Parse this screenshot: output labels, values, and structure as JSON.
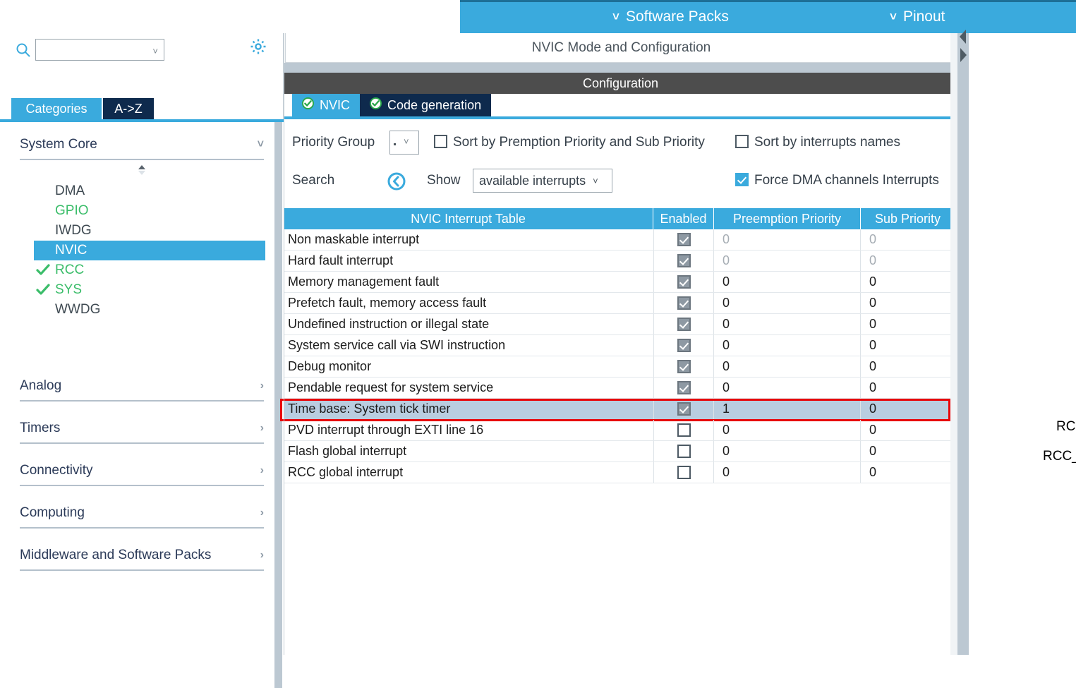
{
  "topbar": {
    "items": [
      {
        "label": "Software Packs",
        "icon": "chevron-down-icon"
      },
      {
        "label": "Pinout",
        "icon": "chevron-down-icon"
      }
    ]
  },
  "sidebar": {
    "search": {
      "value": "",
      "placeholder": ""
    },
    "gear_icon": "gear-icon",
    "search_icon": "search-icon",
    "tabs": [
      {
        "label": "Categories",
        "active": true
      },
      {
        "label": "A->Z",
        "active": false
      }
    ],
    "groups": [
      {
        "label": "System Core",
        "expanded": true,
        "arrow": "chevron-down-icon",
        "items": [
          {
            "label": "DMA",
            "state": "normal",
            "check": false
          },
          {
            "label": "GPIO",
            "state": "configured",
            "check": false
          },
          {
            "label": "IWDG",
            "state": "normal",
            "check": false
          },
          {
            "label": "NVIC",
            "state": "selected",
            "check": false
          },
          {
            "label": "RCC",
            "state": "configured",
            "check": true
          },
          {
            "label": "SYS",
            "state": "configured",
            "check": true
          },
          {
            "label": "WWDG",
            "state": "normal",
            "check": false
          }
        ]
      },
      {
        "label": "Analog",
        "expanded": false,
        "arrow": "chevron-right-icon",
        "items": []
      },
      {
        "label": "Timers",
        "expanded": false,
        "arrow": "chevron-right-icon",
        "items": []
      },
      {
        "label": "Connectivity",
        "expanded": false,
        "arrow": "chevron-right-icon",
        "items": []
      },
      {
        "label": "Computing",
        "expanded": false,
        "arrow": "chevron-right-icon",
        "items": []
      },
      {
        "label": "Middleware and Software Packs",
        "expanded": false,
        "arrow": "chevron-right-icon",
        "items": []
      }
    ]
  },
  "main": {
    "panel_title": "NVIC Mode and Configuration",
    "configuration_bar": "Configuration",
    "tabs": [
      {
        "label": "NVIC",
        "active": true,
        "icon": "green-check-circle-icon"
      },
      {
        "label": "Code generation",
        "active": false,
        "icon": "green-check-circle-icon"
      }
    ],
    "controls": {
      "priority_group_label": "Priority Group",
      "priority_group_value": ".",
      "sort_premption_label": "Sort by Premption Priority and Sub Priority",
      "sort_premption_checked": false,
      "sort_names_label": "Sort by interrupts names",
      "sort_names_checked": false,
      "search_label": "Search",
      "search_icon": "search-circle-icon",
      "show_label": "Show",
      "show_value": "available interrupts",
      "force_dma_label": "Force DMA channels Interrupts",
      "force_dma_checked": true
    },
    "table": {
      "columns": [
        "NVIC Interrupt Table",
        "Enabled",
        "Preemption Priority",
        "Sub Priority"
      ],
      "rows": [
        {
          "name": "Non maskable interrupt",
          "enabled": "disabled-checked",
          "preemption": "0",
          "sub": "0",
          "muted": true,
          "highlight": false
        },
        {
          "name": "Hard fault interrupt",
          "enabled": "disabled-checked",
          "preemption": "0",
          "sub": "0",
          "muted": true,
          "highlight": false
        },
        {
          "name": "Memory management fault",
          "enabled": "disabled-checked",
          "preemption": "0",
          "sub": "0",
          "muted": false,
          "highlight": false
        },
        {
          "name": "Prefetch fault, memory access fault",
          "enabled": "disabled-checked",
          "preemption": "0",
          "sub": "0",
          "muted": false,
          "highlight": false
        },
        {
          "name": "Undefined instruction or illegal state",
          "enabled": "disabled-checked",
          "preemption": "0",
          "sub": "0",
          "muted": false,
          "highlight": false
        },
        {
          "name": "System service call via SWI instruction",
          "enabled": "disabled-checked",
          "preemption": "0",
          "sub": "0",
          "muted": false,
          "highlight": false
        },
        {
          "name": "Debug monitor",
          "enabled": "disabled-checked",
          "preemption": "0",
          "sub": "0",
          "muted": false,
          "highlight": false
        },
        {
          "name": "Pendable request for system service",
          "enabled": "disabled-checked",
          "preemption": "0",
          "sub": "0",
          "muted": false,
          "highlight": false
        },
        {
          "name": "Time base: System tick timer",
          "enabled": "disabled-checked",
          "preemption": "1",
          "sub": "0",
          "muted": false,
          "highlight": true
        },
        {
          "name": "PVD interrupt through EXTI line 16",
          "enabled": "unchecked",
          "preemption": "0",
          "sub": "0",
          "muted": false,
          "highlight": false
        },
        {
          "name": "Flash global interrupt",
          "enabled": "unchecked",
          "preemption": "0",
          "sub": "0",
          "muted": false,
          "highlight": false
        },
        {
          "name": "RCC global interrupt",
          "enabled": "unchecked",
          "preemption": "0",
          "sub": "0",
          "muted": false,
          "highlight": false
        }
      ]
    }
  },
  "right_panel": {
    "partial_labels": [
      "RC",
      "RCC_"
    ]
  }
}
